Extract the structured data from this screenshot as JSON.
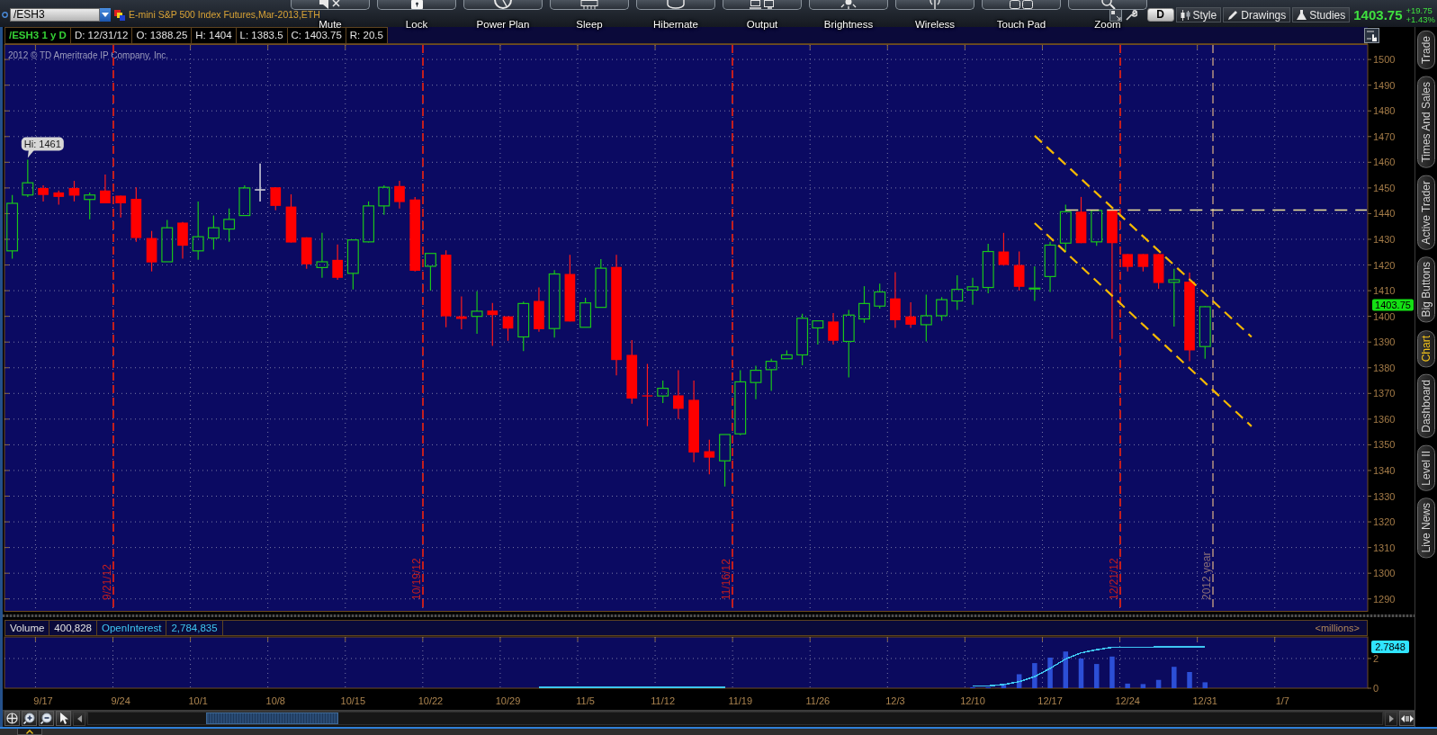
{
  "top_bar": {
    "symbol_field": {
      "value": "/ESH3"
    },
    "description": "E-mini S&P 500 Index Futures,Mar-2013,ETH",
    "period_button": "D",
    "tools": [
      {
        "label": "Style"
      },
      {
        "label": "Drawings"
      },
      {
        "label": "Studies"
      }
    ],
    "last_price": "1403.75",
    "net_change": "+19.75",
    "percent_change": "+1.43%"
  },
  "flyout": {
    "buttons": [
      {
        "label": "Mute"
      },
      {
        "label": "Lock"
      },
      {
        "label": "Power Plan"
      },
      {
        "label": "Sleep"
      },
      {
        "label": "Hibernate"
      },
      {
        "label": "Output"
      },
      {
        "label": "Brightness"
      },
      {
        "label": "Wireless"
      },
      {
        "label": "Touch Pad"
      },
      {
        "label": "Zoom"
      }
    ]
  },
  "quote_bar": {
    "title": "/ESH3 1 y D",
    "fields": [
      "D: 12/31/12",
      "O: 1388.25",
      "H: 1404",
      "L: 1383.5",
      "C: 1403.75",
      "R: 20.5"
    ]
  },
  "price_chart": {
    "copyright": "2012 © TD Ameritrade IP Company, Inc.",
    "axis_labels": [
      "1500",
      "1490",
      "1480",
      "1470",
      "1460",
      "1450",
      "1440",
      "1430",
      "1420",
      "1410",
      "1400",
      "1390",
      "1380",
      "1370",
      "1360",
      "1350",
      "1340",
      "1330",
      "1320",
      "1310",
      "1300",
      "1290"
    ],
    "high_callout": "Hi: 1461",
    "date_markers": [
      {
        "text": "9/21/12",
        "color": "#c41e1e"
      },
      {
        "text": "10/19/12",
        "color": "#c41e1e"
      },
      {
        "text": "11/16/12",
        "color": "#c41e1e"
      },
      {
        "text": "12/21/12",
        "color": "#c41e1e"
      },
      {
        "text": "2012 year",
        "color": "#8a6f78"
      }
    ],
    "last_price_badge": "1403.75"
  },
  "volume_panel": {
    "legend_values": [
      "400,828",
      "2,784,835"
    ],
    "unit": "<millions>",
    "value_badge": "2.7848",
    "chart_data": {
      "type": "bar",
      "categories": [
        null,
        null,
        "9/17",
        null,
        null,
        null,
        null,
        "9/24",
        null,
        null,
        null,
        null,
        "10/1",
        null,
        null,
        null,
        null,
        "10/8",
        null,
        null,
        null,
        null,
        "10/15",
        null,
        null,
        null,
        null,
        "10/22",
        null,
        null,
        null,
        null,
        "10/29",
        null,
        null,
        null,
        null,
        "11/5",
        null,
        null,
        null,
        null,
        "11/12",
        null,
        null,
        null,
        null,
        "11/19",
        null,
        null,
        null,
        null,
        "11/26",
        null,
        null,
        null,
        null,
        "12/3",
        null,
        null,
        null,
        null,
        "12/10",
        null,
        null,
        null,
        null,
        "12/17",
        null,
        null,
        null,
        null,
        "12/24",
        null,
        null,
        null,
        null,
        "12/31",
        null,
        null,
        null,
        null,
        "1/7",
        null,
        null,
        null,
        null,
        null
      ],
      "series": [
        {
          "name": "Volume",
          "color": "#2c4fd6",
          "values": [
            null,
            null,
            null,
            null,
            null,
            null,
            null,
            null,
            null,
            null,
            null,
            null,
            null,
            null,
            null,
            null,
            null,
            null,
            null,
            null,
            null,
            null,
            null,
            null,
            null,
            null,
            null,
            null,
            null,
            null,
            null,
            null,
            null,
            null,
            null,
            null,
            null,
            null,
            null,
            null,
            null,
            null,
            null,
            null,
            null,
            null,
            null,
            null,
            null,
            null,
            null,
            null,
            null,
            null,
            null,
            null,
            null,
            null,
            null,
            null,
            null,
            null,
            0.06,
            0.06,
            0.25,
            0.94,
            1.69,
            2.06,
            2.47,
            2,
            1.63,
            2.13,
            0.31,
            0.28,
            0.56,
            1.44,
            1.09,
            0.4,
            null,
            null,
            null,
            null,
            null,
            null,
            null,
            null,
            null,
            null
          ]
        },
        {
          "name": "OpenInterest",
          "type": "line",
          "color": "#3ec6f2",
          "values": [
            null,
            null,
            null,
            null,
            null,
            null,
            null,
            null,
            null,
            null,
            null,
            null,
            null,
            null,
            null,
            null,
            null,
            null,
            null,
            null,
            null,
            null,
            null,
            null,
            null,
            null,
            null,
            null,
            null,
            null,
            null,
            null,
            null,
            null,
            0.06,
            0.06,
            0.06,
            0.06,
            0.06,
            0.06,
            0.06,
            0.06,
            0.06,
            0.06,
            0.06,
            0.06,
            0.06,
            null,
            null,
            null,
            null,
            null,
            null,
            null,
            null,
            null,
            null,
            null,
            null,
            null,
            null,
            null,
            0.16,
            0.16,
            0.25,
            0.44,
            0.78,
            1.34,
            1.97,
            2.38,
            2.59,
            2.75,
            2.75,
            2.75,
            2.78,
            2.78,
            2.78,
            2.78,
            null,
            null,
            null,
            null,
            null,
            null,
            null,
            null,
            null,
            null
          ]
        }
      ],
      "ylim": [
        0,
        3.45
      ],
      "yticks": [
        0,
        2
      ],
      "grid": true
    }
  },
  "side_tabs": [
    {
      "label": "Trade",
      "selected": false
    },
    {
      "label": "Times And Sales",
      "selected": false
    },
    {
      "label": "Active Trader",
      "selected": false
    },
    {
      "label": "Big Buttons",
      "selected": false
    },
    {
      "label": "Chart",
      "selected": true
    },
    {
      "label": "Dashboard",
      "selected": false
    },
    {
      "label": "Level II",
      "selected": false
    },
    {
      "label": "Live News",
      "selected": false
    }
  ]
}
